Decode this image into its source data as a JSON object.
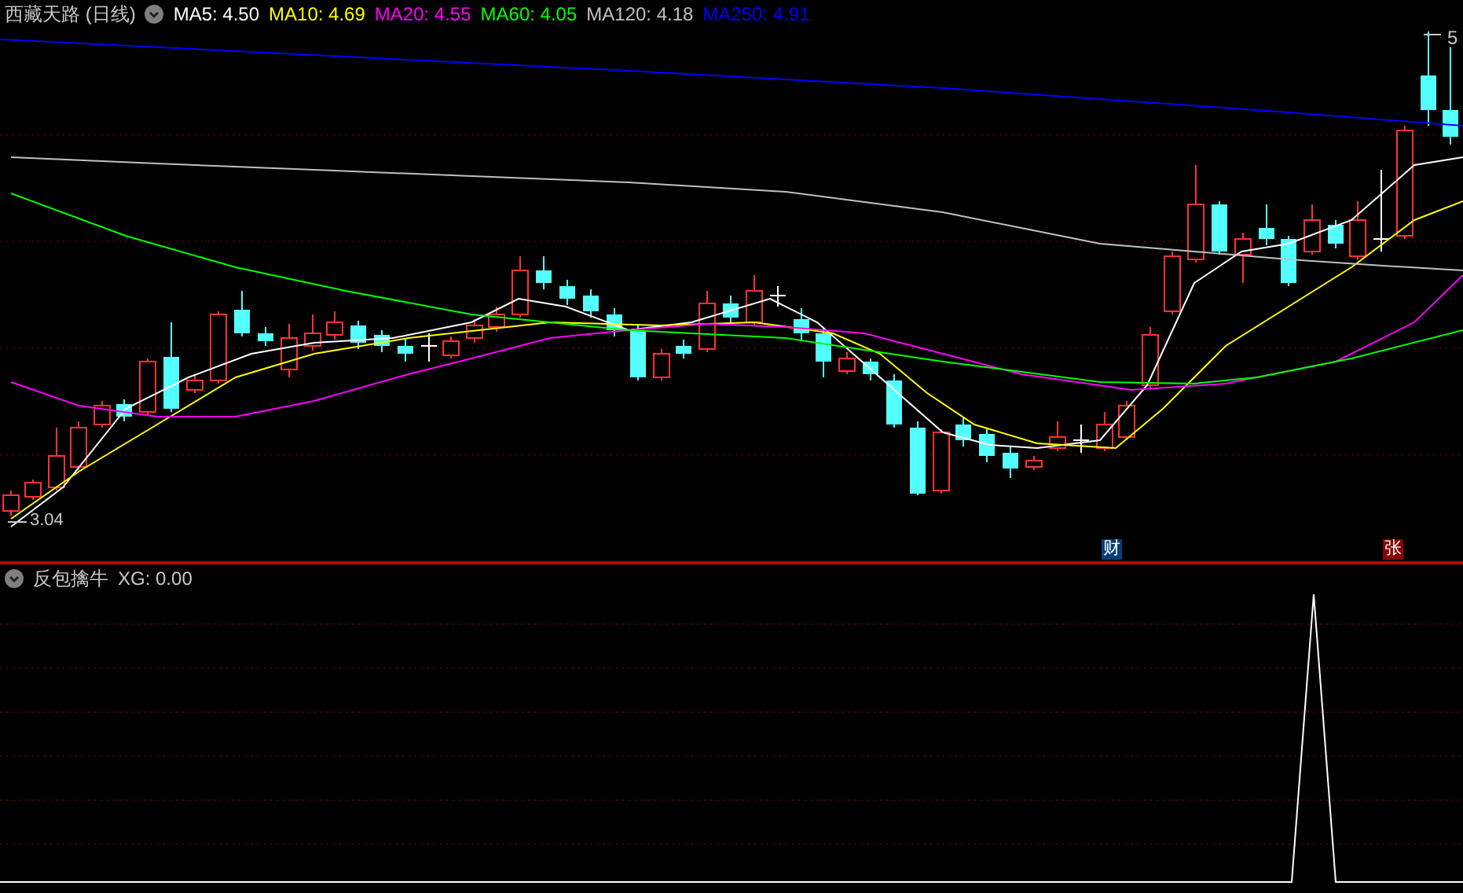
{
  "main_chart": {
    "title": "西藏天路 (日线)",
    "ma_legend": [
      {
        "label": "MA5: 4.50",
        "color": "#ffffff"
      },
      {
        "label": "MA10: 4.69",
        "color": "#ffff00"
      },
      {
        "label": "MA20: 4.55",
        "color": "#ff00ff"
      },
      {
        "label": "MA60: 4.05",
        "color": "#00ff00"
      },
      {
        "label": "MA120: 4.18",
        "color": "#c0c0c0"
      },
      {
        "label": "MA250: 4.91",
        "color": "#0000ff"
      }
    ],
    "high_label": "5",
    "low_label": "3.04",
    "event_markers": [
      {
        "text": "财",
        "color": "#0a3d7a"
      },
      {
        "text": "张",
        "color": "#8b0000"
      }
    ]
  },
  "indicator": {
    "title": "反包擒牛",
    "value": "XG: 0.00"
  }
}
